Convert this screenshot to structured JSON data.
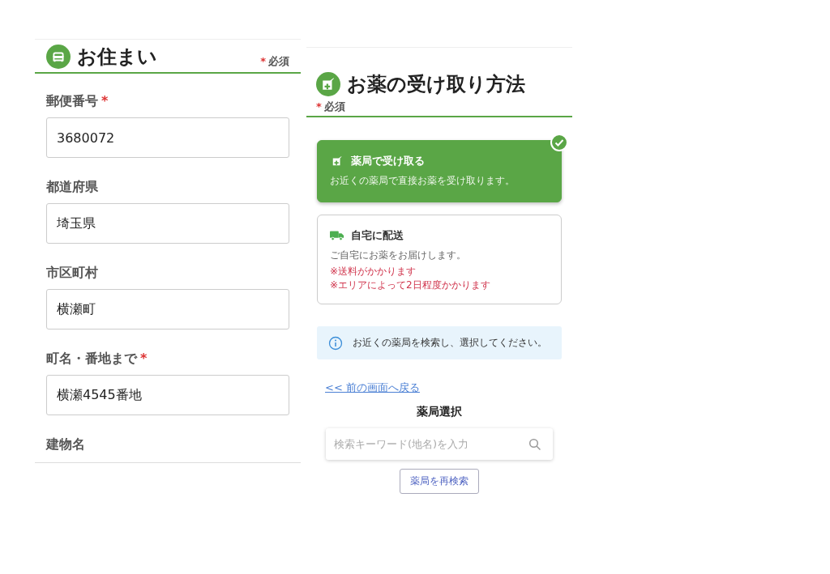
{
  "address": {
    "title": "お住まい",
    "required_note": {
      "mark": "*",
      "text": "必須"
    },
    "fields": [
      {
        "label": "郵便番号",
        "required_mark": "*",
        "value": "3680072"
      },
      {
        "label": "都道府県",
        "value": "埼玉県"
      },
      {
        "label": "市区町村",
        "value": "横瀬町"
      },
      {
        "label": "町名・番地まで",
        "required_mark": "*",
        "value": "横瀬4545番地"
      }
    ],
    "cut_label": "建物名"
  },
  "pickup": {
    "title": "お薬の受け取り方法",
    "required_note": {
      "mark": "*",
      "text": "必須"
    },
    "options": [
      {
        "kind": "pharmacy",
        "title": "薬局で受け取る",
        "description": "お近くの薬局で直接お薬を受け取ります。",
        "selected": true
      },
      {
        "kind": "delivery",
        "title": "自宅に配送",
        "description": "ご自宅にお薬をお届けします。",
        "notes": [
          "※送料がかかります",
          "※エリアによって2日程度かかります"
        ],
        "selected": false
      }
    ],
    "info": "お近くの薬局を検索し、選択してください。",
    "back_link": "<< 前の画面へ戻る",
    "heading": "薬局選択",
    "search": {
      "placeholder": "検索キーワード(地名)を入力"
    },
    "button": "薬局を再検索"
  }
}
